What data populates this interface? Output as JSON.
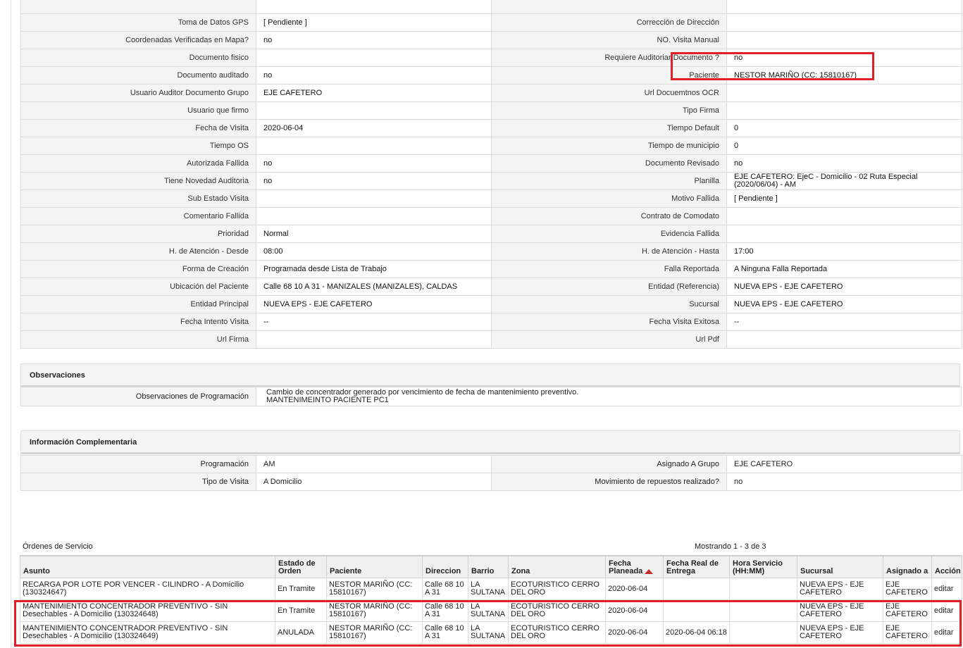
{
  "detail_rows": [
    {
      "l1": "",
      "v1": "",
      "l2": "",
      "v2": ""
    },
    {
      "l1": "Toma de Datos GPS",
      "v1": "[ Pendiente ]",
      "l2": "Corrección de Dirección",
      "v2": ""
    },
    {
      "l1": "Coordenadas Verificadas en Mapa?",
      "v1": "no",
      "l2": "NO. Visita Manual",
      "v2": ""
    },
    {
      "l1": "Documento fisico",
      "v1": "",
      "l2": "Requiere Auditoriar Documento ?",
      "v2": "no"
    },
    {
      "l1": "Documento auditado",
      "v1": "no",
      "l2": "Paciente",
      "v2": "NESTOR MARIÑO (CC: 15810167)"
    },
    {
      "l1": "Usuario Auditor Documento Grupo",
      "v1": "EJE CAFETERO",
      "l2": "Url Docuemtnos OCR",
      "v2": ""
    },
    {
      "l1": "Usuario que firmo",
      "v1": "",
      "l2": "Tipo Firma",
      "v2": ""
    },
    {
      "l1": "Fecha de Visita",
      "v1": "2020-06-04",
      "l2": "Tiempo Default",
      "v2": "0"
    },
    {
      "l1": "Tiempo OS",
      "v1": "",
      "l2": "Tiempo de municipio",
      "v2": "0"
    },
    {
      "l1": "Autorizada Fallida",
      "v1": "no",
      "l2": "Documento Revisado",
      "v2": "no"
    },
    {
      "l1": "Tiene Novedad Auditoria",
      "v1": "no",
      "l2": "Planilla",
      "v2": "EJE CAFETERO: EjeC - Domicilio - 02 Ruta Especial (2020/06/04) - AM"
    },
    {
      "l1": "Sub Estado Visita",
      "v1": "",
      "l2": "Motivo Fallida",
      "v2": "[ Pendiente ]"
    },
    {
      "l1": "Comentario Fallida",
      "v1": "",
      "l2": "Contrato de Comodato",
      "v2": ""
    },
    {
      "l1": "Prioridad",
      "v1": "Normal",
      "l2": "Evidencia Fallida",
      "v2": ""
    },
    {
      "l1": "H. de Atención - Desde",
      "v1": "08:00",
      "l2": "H. de Atención - Hasta",
      "v2": "17:00"
    },
    {
      "l1": "Forma de Creación",
      "v1": "Programada desde Lista de Trabajo",
      "l2": "Falla Reportada",
      "v2": "A Ninguna Falla Reportada"
    },
    {
      "l1": "Ubicación del Paciente",
      "v1": "Calle 68 10 A 31 - MANIZALES (MANIZALES), CALDAS",
      "l2": "Entidad (Referencia)",
      "v2": "NUEVA EPS - EJE CAFETERO"
    },
    {
      "l1": "Entidad Principal",
      "v1": "NUEVA EPS - EJE CAFETERO",
      "l2": "Sucursal",
      "v2": "NUEVA EPS - EJE CAFETERO"
    },
    {
      "l1": "Fecha Intento Visita",
      "v1": "--",
      "l2": "Fecha Visita Exitosa",
      "v2": "--"
    },
    {
      "l1": "Url Firma",
      "v1": "",
      "l2": "Url Pdf",
      "v2": ""
    }
  ],
  "observaciones": {
    "title": "Observaciones",
    "label": "Observaciones de Programación",
    "line1": "Cambio de concentrador generado por vencimiento de fecha de mantenimiento preventivo.",
    "line2": "MANTENIMEINTO PACIENTE PC1"
  },
  "info": {
    "title": "Información Complementaria",
    "rows": [
      {
        "l1": "Programación",
        "v1": "AM",
        "l2": "Asignado A Grupo",
        "v2": "EJE CAFETERO"
      },
      {
        "l1": "Tipo de Visita",
        "v1": "A Domicilio",
        "l2": "Movimiento de repuestos realizado?",
        "v2": "no"
      }
    ]
  },
  "orders": {
    "title": "Órdenes de Servicio",
    "count": "Mostrando 1 - 3 de 3",
    "headers": {
      "asunto": "Asunto",
      "estado": "Estado de Orden",
      "paciente": "Paciente",
      "direccion": "Direccion",
      "barrio": "Barrio",
      "zona": "Zona",
      "fecha_planeada": "Fecha Planeada",
      "fecha_real": "Fecha Real de Entrega",
      "hora": "Hora Servicio (HH:MM)",
      "sucursal": "Sucursal",
      "asignado": "Asignado a",
      "accion": "Acción"
    },
    "rows": [
      {
        "asunto": "RECARGA POR LOTE POR VENCER - CILINDRO - A Domicilio (130324647)",
        "estado": "En Tramite",
        "paciente": "NESTOR MARIÑO (CC: 15810167)",
        "direccion": "Calle 68 10 A 31",
        "barrio": "LA SULTANA",
        "zona": "ECOTURISTICO CERRO DEL ORO",
        "fecha_planeada": "2020-06-04",
        "fecha_real": "",
        "hora": "",
        "sucursal": "NUEVA EPS - EJE CAFETERO",
        "asignado": "EJE CAFETERO",
        "accion": "editar"
      },
      {
        "asunto": "MANTENIMIENTO CONCENTRADOR PREVENTIVO - SIN Desechables - A Domicilio (130324648)",
        "estado": "En Tramite",
        "paciente": "NESTOR MARIÑO (CC: 15810167)",
        "direccion": "Calle 68 10 A 31",
        "barrio": "LA SULTANA",
        "zona": "ECOTURISTICO CERRO DEL ORO",
        "fecha_planeada": "2020-06-04",
        "fecha_real": "",
        "hora": "",
        "sucursal": "NUEVA EPS - EJE CAFETERO",
        "asignado": "EJE CAFETERO",
        "accion": "editar"
      },
      {
        "asunto": "MANTENIMIENTO CONCENTRADOR PREVENTIVO - SIN Desechables - A Domicilio (130324649)",
        "estado": "ANULADA",
        "paciente": "NESTOR MARIÑO (CC: 15810167)",
        "direccion": "Calle 68 10 A 31",
        "barrio": "LA SULTANA",
        "zona": "ECOTURISTICO CERRO DEL ORO",
        "fecha_planeada": "2020-06-04",
        "fecha_real": "2020-06-04 06:18",
        "hora": "",
        "sucursal": "NUEVA EPS - EJE CAFETERO",
        "asignado": "EJE CAFETERO",
        "accion": "editar"
      }
    ]
  },
  "highlight_color": "#e21f26"
}
